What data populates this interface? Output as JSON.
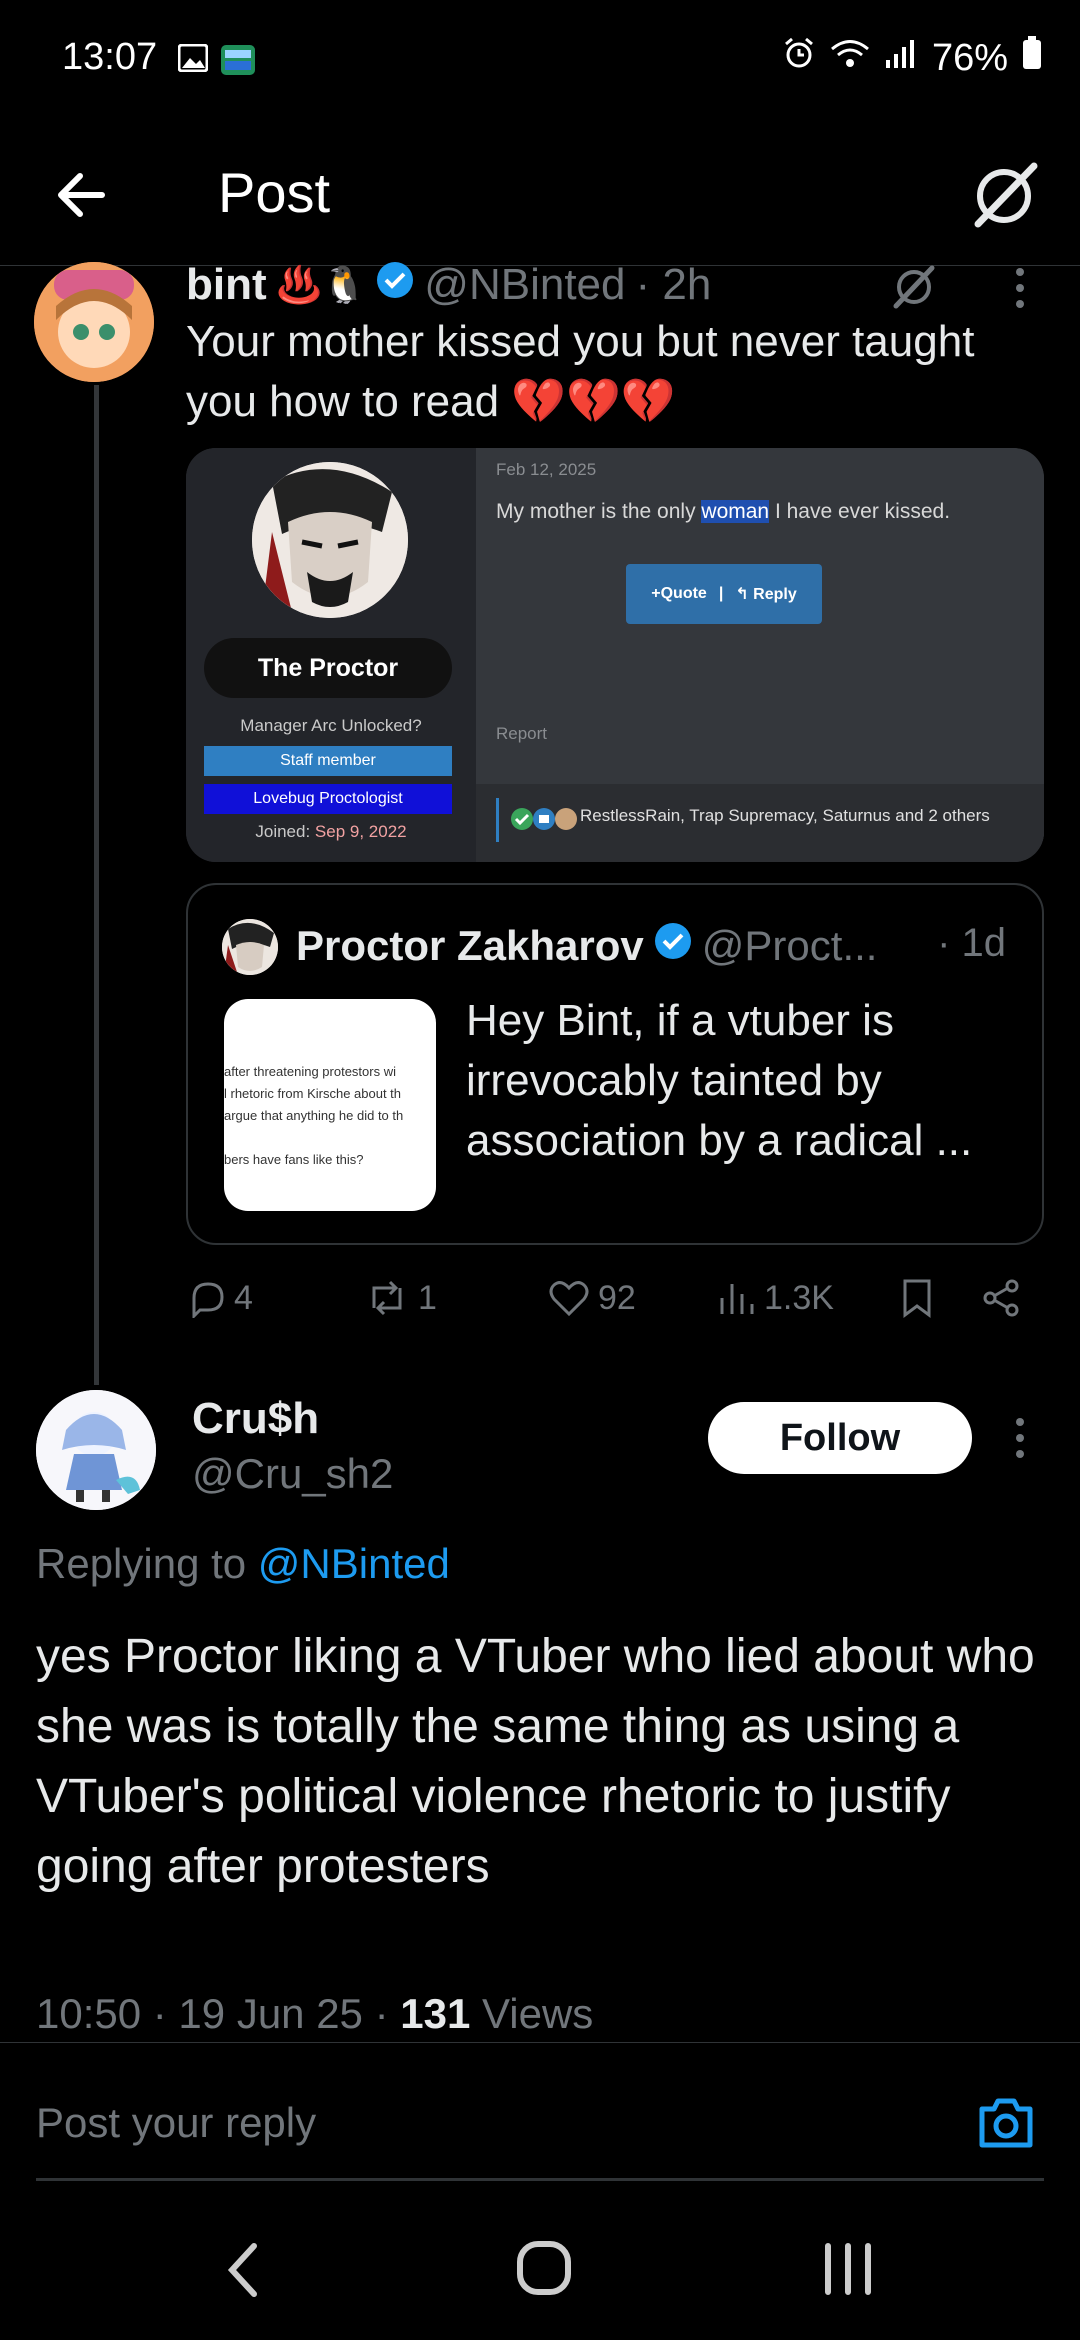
{
  "status": {
    "time": "13:07",
    "battery": "76%"
  },
  "header": {
    "title": "Post"
  },
  "post": {
    "display_name": "bint",
    "emoji_badges": "♨️🐧",
    "handle": "@NBinted",
    "time": "· 2h",
    "text": "Your mother kissed you but never taught you how to read 💔💔💔",
    "media": {
      "profile_name": "The Proctor",
      "role_line": "Manager Arc Unlocked?",
      "badge1": "Staff member",
      "badge2": "Lovebug Proctologist",
      "joined_label": "Joined:",
      "joined_date": "Sep 9, 2022",
      "date": "Feb 12, 2025",
      "message_pre": "My mother is the only ",
      "message_highlight": "woman",
      "message_post": " I have ever kissed.",
      "quote_label": "+Quote",
      "reply_label": "↰ Reply",
      "report_label": "Report",
      "reactions_text": "RestlessRain, Trap Supremacy, Saturnus and 2 others"
    },
    "quoted": {
      "display_name": "Proctor Zakharov",
      "handle": "@Proct...",
      "time": "· 1d",
      "text": "Hey Bint, if a vtuber is irrevocably tainted by association by a radical ...",
      "thumb_lines": [
        "after threatening protestors wi",
        "l rhetoric from Kirsche about th",
        "argue that anything he did to th",
        "",
        "bers have fans like this?"
      ]
    },
    "stats": {
      "replies": "4",
      "reposts": "1",
      "likes": "92",
      "views": "1.3K"
    }
  },
  "reply": {
    "display_name": "Cru$h",
    "handle": "@Cru_sh2",
    "follow_label": "Follow",
    "replying_prefix": "Replying to ",
    "replying_handle": "@NBinted",
    "text": "yes Proctor liking a VTuber who lied about who she was is totally the same thing as using a VTuber's political violence rhetoric to justify going after protesters",
    "meta_time": "10:50 · 19 Jun 25 · ",
    "meta_views_count": "131",
    "meta_views_label": " Views"
  },
  "compose": {
    "placeholder": "Post your reply"
  },
  "colors": {
    "accent": "#1d9bf0",
    "background": "#000000",
    "muted": "#71767b"
  }
}
